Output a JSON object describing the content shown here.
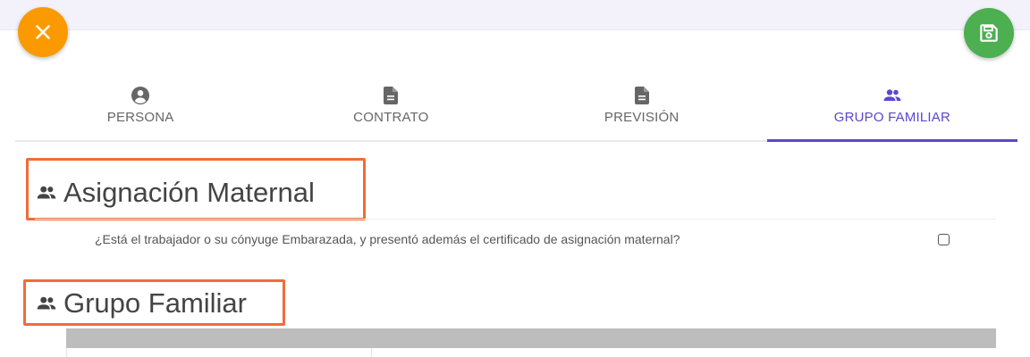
{
  "actions": {
    "close_icon": "close-icon",
    "save_icon": "floppy-disk-icon",
    "close_color": "#fb9a00",
    "save_color": "#4caf50"
  },
  "tabs": [
    {
      "label": "PERSONA",
      "icon": "account-circle-icon",
      "active": false
    },
    {
      "label": "CONTRATO",
      "icon": "document-icon",
      "active": false
    },
    {
      "label": "PREVISIÓN",
      "icon": "document-icon",
      "active": false
    },
    {
      "label": "GRUPO FAMILIAR",
      "icon": "people-icon",
      "active": true
    }
  ],
  "accent_color": "#5c46d2",
  "highlight_color": "#f26b3a",
  "sections": {
    "maternal": {
      "title": "Asignación Maternal",
      "icon": "people-icon",
      "question": "¿Está el trabajador o su cónyuge Embarazada, y presentó además el certificado de asignación maternal?",
      "checked": false
    },
    "family": {
      "title": "Grupo Familiar",
      "icon": "people-icon"
    }
  }
}
